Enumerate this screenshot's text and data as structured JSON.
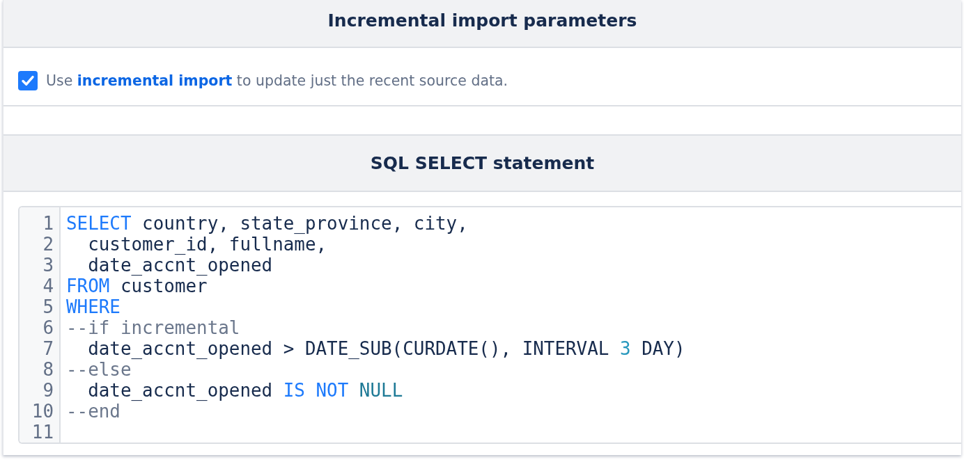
{
  "parameters_panel": {
    "title": "Incremental import parameters",
    "option": {
      "checked": true,
      "text_before": "Use",
      "link": "incremental import",
      "text_after": "to update just the recent source data."
    }
  },
  "sql_panel": {
    "title": "SQL SELECT statement",
    "lines": [
      {
        "number": "1",
        "tokens": [
          {
            "kind": "keyword",
            "text": "SELECT"
          },
          {
            "kind": "plain",
            "text": " country, state_province, city,"
          }
        ]
      },
      {
        "number": "2",
        "tokens": [
          {
            "kind": "plain",
            "text": "  customer_id, fullname,"
          }
        ]
      },
      {
        "number": "3",
        "tokens": [
          {
            "kind": "plain",
            "text": "  date_accnt_opened"
          }
        ]
      },
      {
        "number": "4",
        "tokens": [
          {
            "kind": "keyword",
            "text": "FROM"
          },
          {
            "kind": "plain",
            "text": " customer"
          }
        ]
      },
      {
        "number": "5",
        "tokens": [
          {
            "kind": "keyword",
            "text": "WHERE"
          }
        ]
      },
      {
        "number": "6",
        "tokens": [
          {
            "kind": "comment",
            "text": "--if incremental"
          }
        ]
      },
      {
        "number": "7",
        "tokens": [
          {
            "kind": "plain",
            "text": "  date_accnt_opened > DATE_SUB(CURDATE(), INTERVAL "
          },
          {
            "kind": "number",
            "text": "3"
          },
          {
            "kind": "plain",
            "text": " DAY)"
          }
        ]
      },
      {
        "number": "8",
        "tokens": [
          {
            "kind": "comment",
            "text": "--else"
          }
        ]
      },
      {
        "number": "9",
        "tokens": [
          {
            "kind": "plain",
            "text": "  date_accnt_opened "
          },
          {
            "kind": "keyword",
            "text": "IS NOT"
          },
          {
            "kind": "literal",
            "text": " NULL"
          }
        ]
      },
      {
        "number": "10",
        "tokens": [
          {
            "kind": "comment",
            "text": "--end"
          }
        ]
      },
      {
        "number": "11"
      }
    ]
  }
}
